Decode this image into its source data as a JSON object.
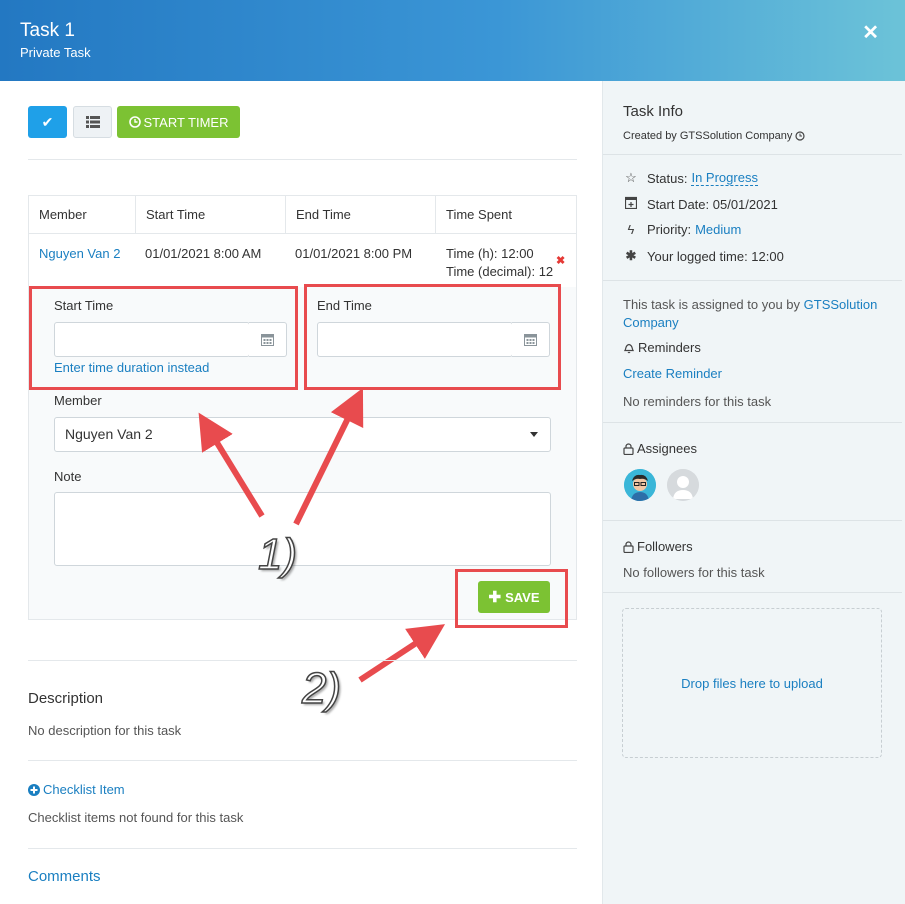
{
  "header": {
    "title": "Task 1",
    "subtitle": "Private Task",
    "close_icon": "close-icon"
  },
  "toolbar": {
    "start_timer_label": "START TIMER"
  },
  "timesheet": {
    "columns": [
      "Member",
      "Start Time",
      "End Time",
      "Time Spent"
    ],
    "row": {
      "member": "Nguyen Van 2",
      "start": "01/01/2021 8:00 AM",
      "end": "01/01/2021 8:00 PM",
      "time_h": "Time (h): 12:00",
      "time_decimal": "Time (decimal): 12"
    }
  },
  "form": {
    "start_time_label": "Start Time",
    "end_time_label": "End Time",
    "duration_link": "Enter time duration instead",
    "member_label": "Member",
    "member_value": "Nguyen Van 2",
    "note_label": "Note",
    "save_label": "SAVE"
  },
  "annotations": {
    "one": "1)",
    "two": "2)"
  },
  "main": {
    "description_title": "Description",
    "description_text": "No description for this task",
    "checklist_link": "Checklist Item",
    "checklist_empty": "Checklist items not found for this task",
    "comments_title": "Comments"
  },
  "task_info": {
    "title": "Task Info",
    "created_by": "Created by GTSSolution Company",
    "status_label": "Status:",
    "status_value": "In Progress",
    "start_date": "Start Date: 05/01/2021",
    "priority_label": "Priority:",
    "priority_value": "Medium",
    "logged_time": "Your logged time: 12:00",
    "assigned_prefix": "This task is assigned to you by",
    "assigned_by": "GTSSolution Company",
    "reminders_title": "Reminders",
    "create_reminder": "Create Reminder",
    "no_reminders": "No reminders for this task",
    "assignees_title": "Assignees",
    "followers_title": "Followers",
    "no_followers": "No followers for this task",
    "dropzone_text": "Drop files here to upload"
  },
  "colors": {
    "accent_blue": "#1fa0e8",
    "green": "#7cc233",
    "link": "#1a7fc1",
    "annotation_red": "#e84b4e"
  }
}
